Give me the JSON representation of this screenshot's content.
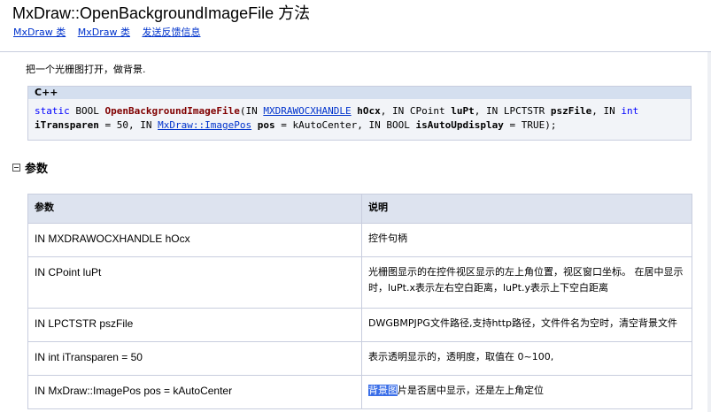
{
  "header": {
    "title": "MxDraw::OpenBackgroundImageFile 方法",
    "links": [
      "MxDraw 类",
      "MxDraw 类",
      "发送反馈信息"
    ]
  },
  "summary": "把一个光栅图打开，做背景.",
  "syntax": {
    "label": "C++",
    "tokens": [
      "static",
      "BOOL",
      "OpenBackgroundImageFile",
      "IN",
      "MXDRAWOCXHANDLE",
      "hOcx",
      "IN",
      "CPoint",
      "luPt",
      "IN",
      "LPCTSTR",
      "pszFile",
      "IN",
      "int",
      "iTransparen",
      "= 50,",
      "IN",
      "MxDraw::ImagePos",
      "pos",
      "= kAutoCenter,",
      "IN",
      "BOOL",
      "isAutoUpdisplay",
      "= TRUE);"
    ]
  },
  "params": {
    "heading": "参数",
    "headers": [
      "参数",
      "说明"
    ],
    "rows": [
      [
        "IN MXDRAWOCXHANDLE hOcx",
        "控件句柄"
      ],
      [
        "IN CPoint luPt",
        "光栅图显示的在控件视区显示的左上角位置，视区窗口坐标。 在居中显示时，luPt.x表示左右空白距离，luPt.y表示上下空白距离"
      ],
      [
        "IN LPCTSTR pszFile",
        "DWGBMPJPG文件路径,支持http路径，文件件名为空时，清空背景文件"
      ],
      [
        "IN int iTransparen = 50",
        "表示透明显示的，透明度，取值在 0~100,"
      ],
      [
        "IN MxDraw::ImagePos pos = kAutoCenter",
        "背景图片是否居中显示，还是左上角定位"
      ]
    ],
    "highlighted_text": "背景图",
    "last_desc_rest": "片是否居中显示，还是左上角定位"
  }
}
